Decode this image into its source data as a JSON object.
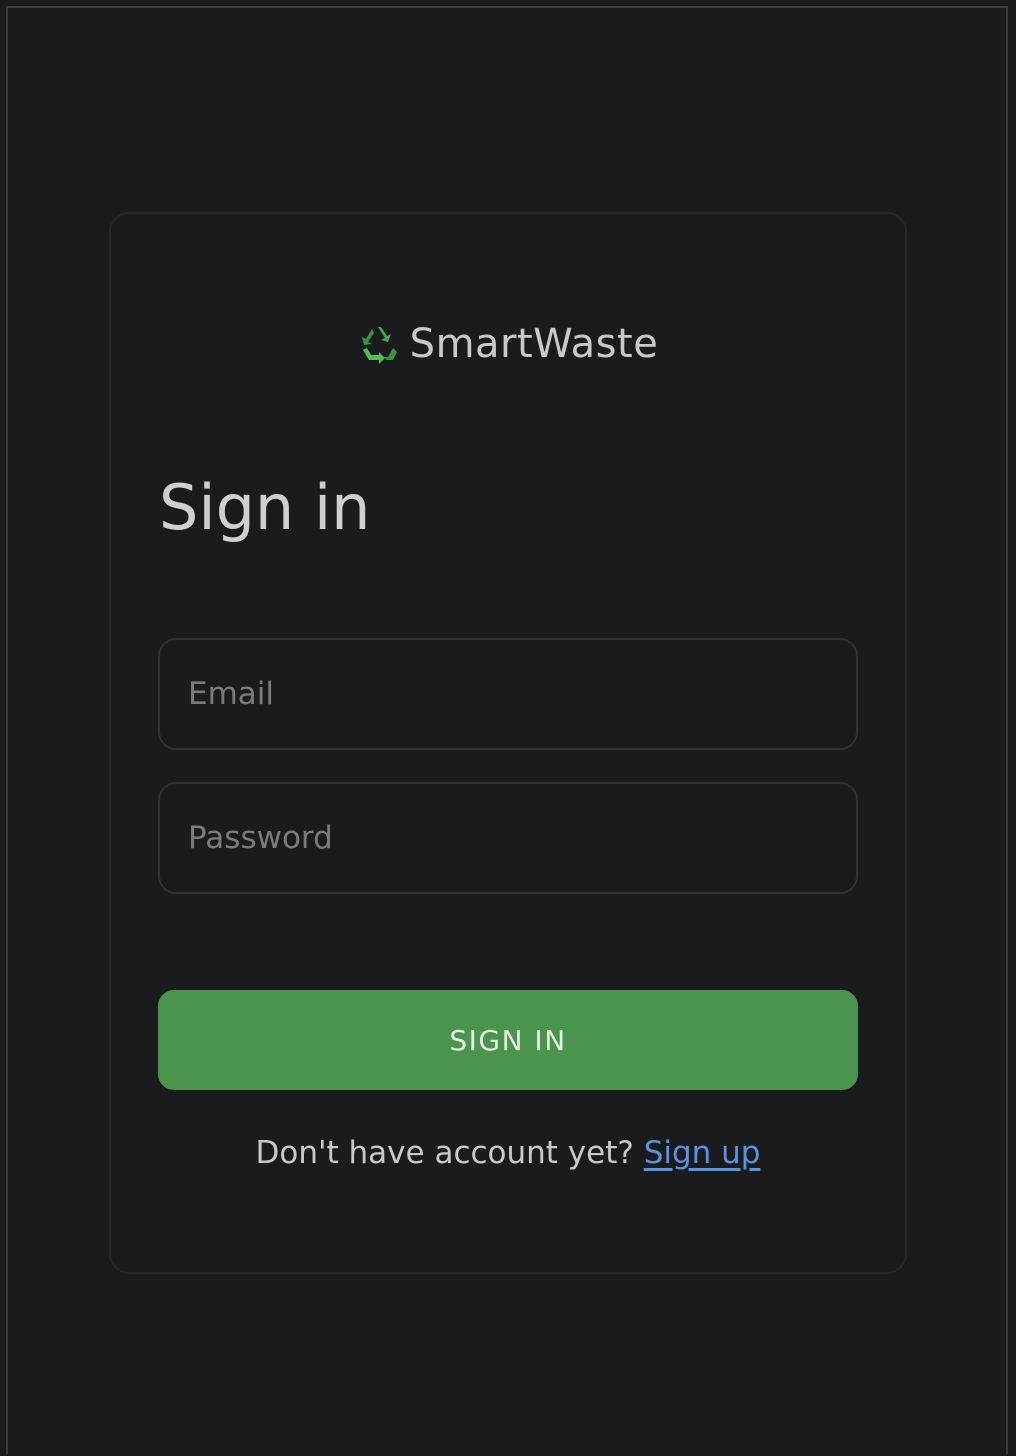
{
  "brand": {
    "name": "SmartWaste",
    "icon": "recycle-icon",
    "icon_color": "#4ca64f"
  },
  "form": {
    "title": "Sign in",
    "email_placeholder": "Email",
    "password_placeholder": "Password",
    "submit_label": "SIGN IN",
    "signup_prompt": "Don't have account yet?",
    "signup_link": "Sign up"
  },
  "colors": {
    "background": "#1a1b1d",
    "primary": "#4b944d",
    "link": "#5a93e0"
  }
}
